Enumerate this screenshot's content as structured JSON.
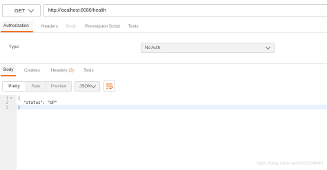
{
  "request": {
    "method": "GET",
    "url": "http://localhost:8080/health"
  },
  "request_tabs": [
    {
      "label": "Authorization",
      "state": "active"
    },
    {
      "label": "Headers",
      "state": "normal"
    },
    {
      "label": "Body",
      "state": "disabled"
    },
    {
      "label": "Pre-request Script",
      "state": "normal"
    },
    {
      "label": "Tests",
      "state": "normal"
    }
  ],
  "auth": {
    "type_label": "Type",
    "type_value": "No Auth"
  },
  "response_tabs": [
    {
      "label": "Body",
      "state": "active"
    },
    {
      "label": "Cookies",
      "state": "normal"
    },
    {
      "label": "Headers",
      "count": "(3)",
      "state": "normal"
    },
    {
      "label": "Tests",
      "state": "normal"
    }
  ],
  "view_modes": [
    "Pretty",
    "Raw",
    "Preview"
  ],
  "format": "JSON",
  "editor": {
    "line_numbers": [
      "1",
      "2",
      "3"
    ],
    "lines": [
      "{",
      "\"status\": \"UP\"",
      "}"
    ]
  },
  "watermark": "https://blog.csdn.net/u013194640",
  "colors": {
    "accent": "#f47023",
    "wrap_icon": "#f47023"
  }
}
